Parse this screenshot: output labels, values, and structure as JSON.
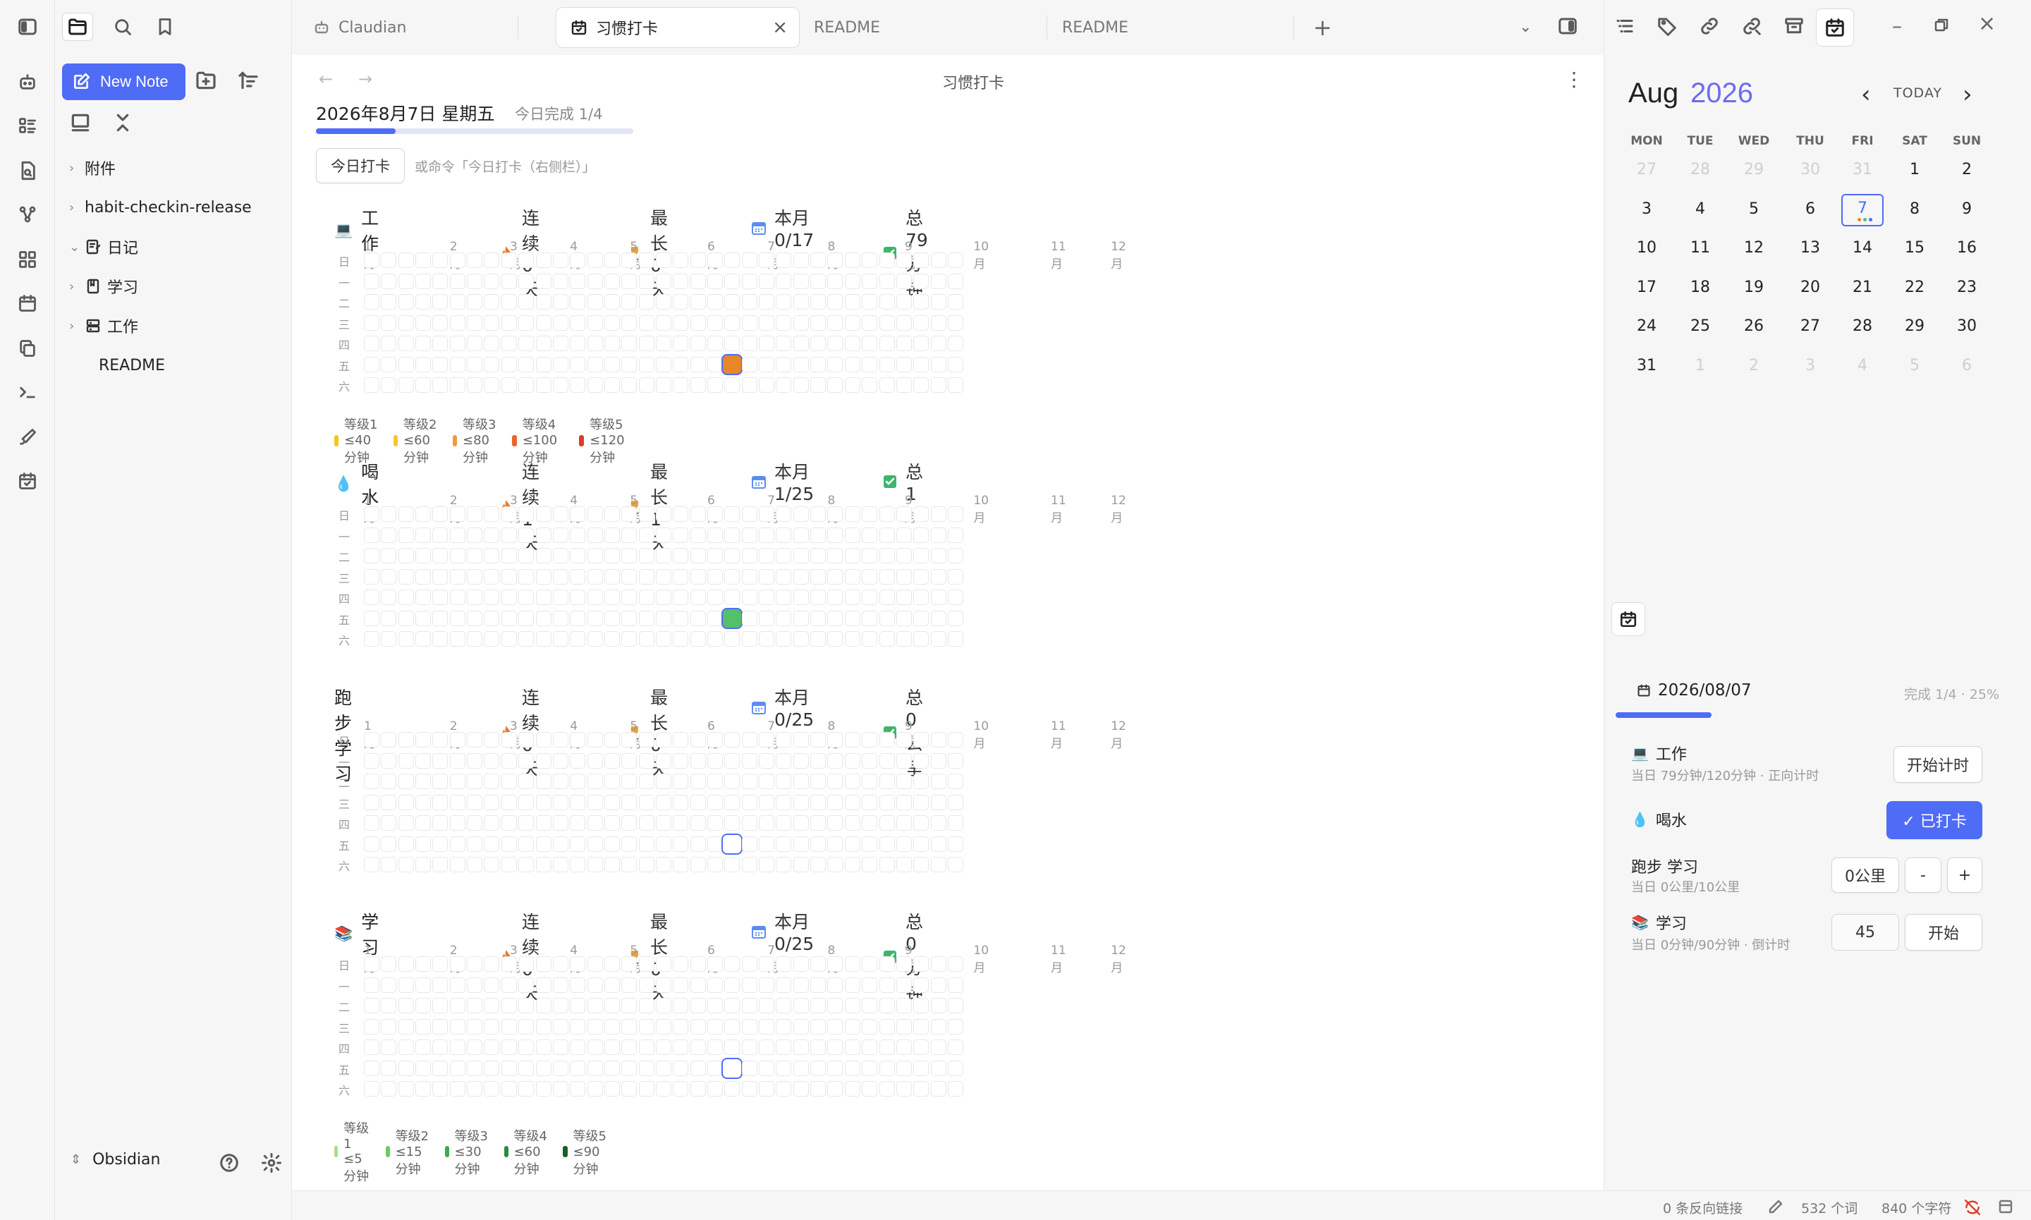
{
  "colors": {
    "accent": "#4f6cf7",
    "work_level4": "#e8862a",
    "water_green": "#55c06a",
    "today_ring": "#4f6cf7"
  },
  "ribbon": {
    "icons": [
      "sidebar-toggle-icon",
      "agent-icon",
      "list-icon",
      "search-doc-icon",
      "graph-icon",
      "grid-icon",
      "calendar-icon",
      "copy-icon",
      "terminal-icon",
      "brush-icon",
      "calendar-check-icon"
    ]
  },
  "sidebar": {
    "new_note": "New Note",
    "items": [
      {
        "label": "附件",
        "type": "folder"
      },
      {
        "label": "habit-checkin-release",
        "type": "folder"
      },
      {
        "label": "日记",
        "type": "folder-open"
      },
      {
        "label": "学习",
        "type": "folder"
      },
      {
        "label": "工作",
        "type": "folder"
      },
      {
        "label": "README",
        "type": "file"
      }
    ],
    "vault": "Obsidian"
  },
  "tabs": [
    {
      "label": "Claudian"
    },
    {
      "label": "习惯打卡"
    },
    {
      "label": "README"
    },
    {
      "label": "README"
    }
  ],
  "view": {
    "title": "习惯打卡",
    "date": "2026年8月7日 星期五",
    "today_progress": "今日完成 1/4",
    "progress_fraction": 0.25,
    "checkin_button": "今日打卡",
    "command_hint": "或命令「今日打卡（右侧栏）」"
  },
  "heatmap_axis": {
    "months": [
      "1月",
      "2月",
      "3月",
      "4月",
      "5月",
      "6月",
      "7月",
      "8月",
      "9月",
      "10月",
      "11月",
      "12月"
    ],
    "days": [
      "日",
      "一",
      "二",
      "三",
      "四",
      "五",
      "六"
    ]
  },
  "habits": [
    {
      "icon": "💻",
      "name": "工作",
      "streak": "连续 0 天",
      "best": "最长 0 天",
      "month": "本月 0/17",
      "total": "总 79分钟",
      "today_color": "#e8862a",
      "today_filled": true,
      "legend": [
        {
          "label": "等级1 ≤40分钟",
          "color": "#f5c518"
        },
        {
          "label": "等级2 ≤60分钟",
          "color": "#f7c531"
        },
        {
          "label": "等级3 ≤80分钟",
          "color": "#ef9a3c"
        },
        {
          "label": "等级4 ≤100分钟",
          "color": "#e8652e"
        },
        {
          "label": "等级5 ≤120分钟",
          "color": "#e03a2a"
        }
      ]
    },
    {
      "icon": "💧",
      "name": "喝水",
      "streak": "连续 1 天",
      "best": "最长 1 天",
      "month": "本月 1/25",
      "total": "总 1",
      "today_color": "#55c06a",
      "today_filled": true,
      "legend": []
    },
    {
      "icon": "",
      "name": "跑步 学习",
      "streak": "连续 0 天",
      "best": "最长 0 天",
      "month": "本月 0/25",
      "total": "总 0公里",
      "today_color": "#ffffff",
      "today_filled": false,
      "legend": []
    },
    {
      "icon": "📚",
      "name": "学习",
      "streak": "连续 0 天",
      "best": "最长 0 天",
      "month": "本月 0/25",
      "total": "总 0分钟",
      "today_color": "#ffffff",
      "today_filled": false,
      "legend": [
        {
          "label": "等级1 ≤5分钟",
          "color": "#a8dc8a"
        },
        {
          "label": "等级2 ≤15分钟",
          "color": "#6cc96a"
        },
        {
          "label": "等级3 ≤30分钟",
          "color": "#3fa85a"
        },
        {
          "label": "等级4 ≤60分钟",
          "color": "#2a8a3e"
        },
        {
          "label": "等级5 ≤90分钟",
          "color": "#1d5e26"
        }
      ]
    }
  ],
  "calendar": {
    "month": "Aug",
    "year": "2026",
    "today_label": "TODAY",
    "dow": [
      "MON",
      "TUE",
      "WED",
      "THU",
      "FRI",
      "SAT",
      "SUN"
    ],
    "weeks": [
      [
        "27",
        "28",
        "29",
        "30",
        "31",
        "1",
        "2"
      ],
      [
        "3",
        "4",
        "5",
        "6",
        "7",
        "8",
        "9"
      ],
      [
        "10",
        "11",
        "12",
        "13",
        "14",
        "15",
        "16"
      ],
      [
        "17",
        "18",
        "19",
        "20",
        "21",
        "22",
        "23"
      ],
      [
        "24",
        "25",
        "26",
        "27",
        "28",
        "29",
        "30"
      ],
      [
        "31",
        "1",
        "2",
        "3",
        "4",
        "5",
        "6"
      ]
    ],
    "today": "7"
  },
  "panel": {
    "date": "2026/08/07",
    "summary": "完成 1/4 · 25%",
    "progress_fraction": 0.25,
    "rows": [
      {
        "icon": "💻",
        "name": "工作",
        "sub": "当日 79分钟/120分钟 · 正向计时",
        "button": "开始计时"
      },
      {
        "icon": "💧",
        "name": "喝水",
        "sub": "",
        "button": "✓ 已打卡"
      },
      {
        "icon": "",
        "name": "跑步 学习",
        "sub": "当日 0公里/10公里",
        "value": "0公里",
        "minus": "-",
        "plus": "+"
      },
      {
        "icon": "📚",
        "name": "学习",
        "sub": "当日 0分钟/90分钟 · 倒计时",
        "value": "45",
        "button": "开始"
      }
    ]
  },
  "status": {
    "backlinks": "0 条反向链接",
    "words": "532 个词",
    "chars": "840 个字符"
  }
}
